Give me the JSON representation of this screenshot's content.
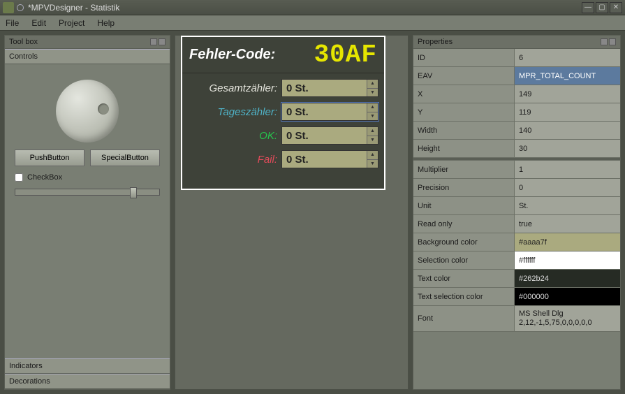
{
  "window": {
    "title": "*MPVDesigner - Statistik"
  },
  "menu": {
    "file": "File",
    "edit": "Edit",
    "project": "Project",
    "help": "Help"
  },
  "toolbox": {
    "title": "Tool box",
    "controls_header": "Controls",
    "pushbutton": "PushButton",
    "specialbutton": "SpecialButton",
    "checkbox": "CheckBox",
    "indicators_header": "Indicators",
    "decorations_header": "Decorations"
  },
  "design": {
    "error_label": "Fehler-Code:",
    "error_code": "30AF",
    "fields": [
      {
        "label": "Gesamtzähler:",
        "class": "lbl-white",
        "value": "0 St."
      },
      {
        "label": "Tageszähler:",
        "class": "lbl-teal",
        "value": "0 St."
      },
      {
        "label": "OK:",
        "class": "lbl-green",
        "value": "0 St."
      },
      {
        "label": "Fail:",
        "class": "lbl-red",
        "value": "0 St."
      }
    ]
  },
  "properties": {
    "title": "Properties",
    "rows": [
      {
        "k": "ID",
        "v": "6"
      },
      {
        "k": "EAV",
        "v": "MPR_TOTAL_COUNT",
        "sel": true
      },
      {
        "k": "X",
        "v": "149"
      },
      {
        "k": "Y",
        "v": "119"
      },
      {
        "k": "Width",
        "v": "140"
      },
      {
        "k": "Height",
        "v": "30"
      }
    ],
    "rows2": [
      {
        "k": "Multiplier",
        "v": "1"
      },
      {
        "k": "Precision",
        "v": "0"
      },
      {
        "k": "Unit",
        "v": "St."
      },
      {
        "k": "Read only",
        "v": "true"
      },
      {
        "k": "Background color",
        "v": "#aaaa7f",
        "vclass": "swatch-light"
      },
      {
        "k": "Selection color",
        "v": "#ffffff",
        "vclass": "swatch-white"
      },
      {
        "k": "Text color",
        "v": "#262b24",
        "vclass": "swatch-dark"
      },
      {
        "k": "Text selection color",
        "v": "#000000",
        "vclass": "swatch-black"
      },
      {
        "k": "Font",
        "v": "MS Shell Dlg 2,12,-1,5,75,0,0,0,0,0",
        "vclass": "font"
      }
    ]
  }
}
